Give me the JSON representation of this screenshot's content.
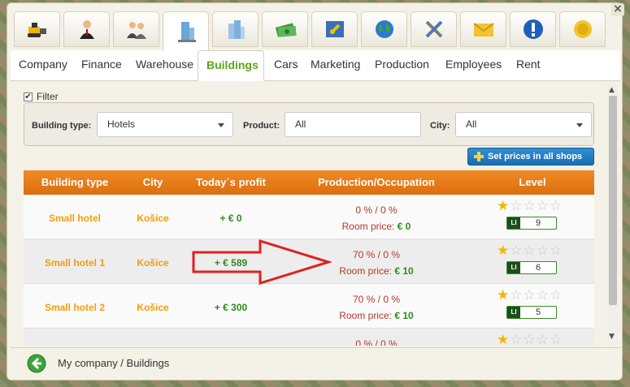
{
  "icon_tabs": [
    {
      "name": "bulldozer-icon"
    },
    {
      "name": "businessman-icon"
    },
    {
      "name": "people-icon"
    },
    {
      "name": "building-icon",
      "active": true
    },
    {
      "name": "city-building-icon"
    },
    {
      "name": "money-icon"
    },
    {
      "name": "map-icon"
    },
    {
      "name": "globe-icon"
    },
    {
      "name": "tools-icon"
    },
    {
      "name": "mail-icon"
    },
    {
      "name": "info-icon"
    },
    {
      "name": "coin-icon"
    }
  ],
  "tabs": [
    {
      "label": "Company"
    },
    {
      "label": "Finance"
    },
    {
      "label": "Warehouse"
    },
    {
      "label": "Buildings",
      "active": true
    },
    {
      "label": "Cars"
    },
    {
      "label": "Marketing"
    },
    {
      "label": "Production"
    },
    {
      "label": "Employees"
    },
    {
      "label": "Rent"
    }
  ],
  "filter": {
    "checkbox_label": "Filter",
    "checked": true,
    "building_type_label": "Building type:",
    "building_type_value": "Hotels",
    "product_label": "Product:",
    "product_value": "All",
    "city_label": "City:",
    "city_value": "All"
  },
  "set_prices_button": "Set prices in all shops",
  "table": {
    "headers": [
      "Building type",
      "City",
      "Today`s profit",
      "Production/Occupation",
      "Level"
    ],
    "rows": [
      {
        "type": "Small hotel",
        "city": "Košice",
        "profit": "+ € 0",
        "occupation": "0 % / 0 %",
        "price_label": "Room price:",
        "price": "€ 0",
        "stars": 1,
        "level": "9",
        "level_badge": "LI"
      },
      {
        "type": "Small hotel 1",
        "city": "Košice",
        "profit": "+ € 589",
        "occupation": "70 % / 0 %",
        "price_label": "Room price:",
        "price": "€ 10",
        "stars": 1,
        "level": "6",
        "level_badge": "LI"
      },
      {
        "type": "Small hotel 2",
        "city": "Košice",
        "profit": "+ € 300",
        "occupation": "70 % / 0 %",
        "price_label": "Room price:",
        "price": "€ 10",
        "stars": 1,
        "level": "5",
        "level_badge": "LI"
      },
      {
        "type": "",
        "city": "",
        "profit": "",
        "occupation": "0 % / 0 %",
        "price_label": "",
        "price": "",
        "stars": 1,
        "level": "",
        "level_badge": ""
      }
    ]
  },
  "footer": {
    "breadcrumb": "My company / Buildings"
  },
  "close_label": "×",
  "colors": {
    "accent_orange": "#f08a24",
    "active_tab_green": "#5aa51e",
    "button_blue": "#1b6db2",
    "arrow_red": "#e02020"
  }
}
